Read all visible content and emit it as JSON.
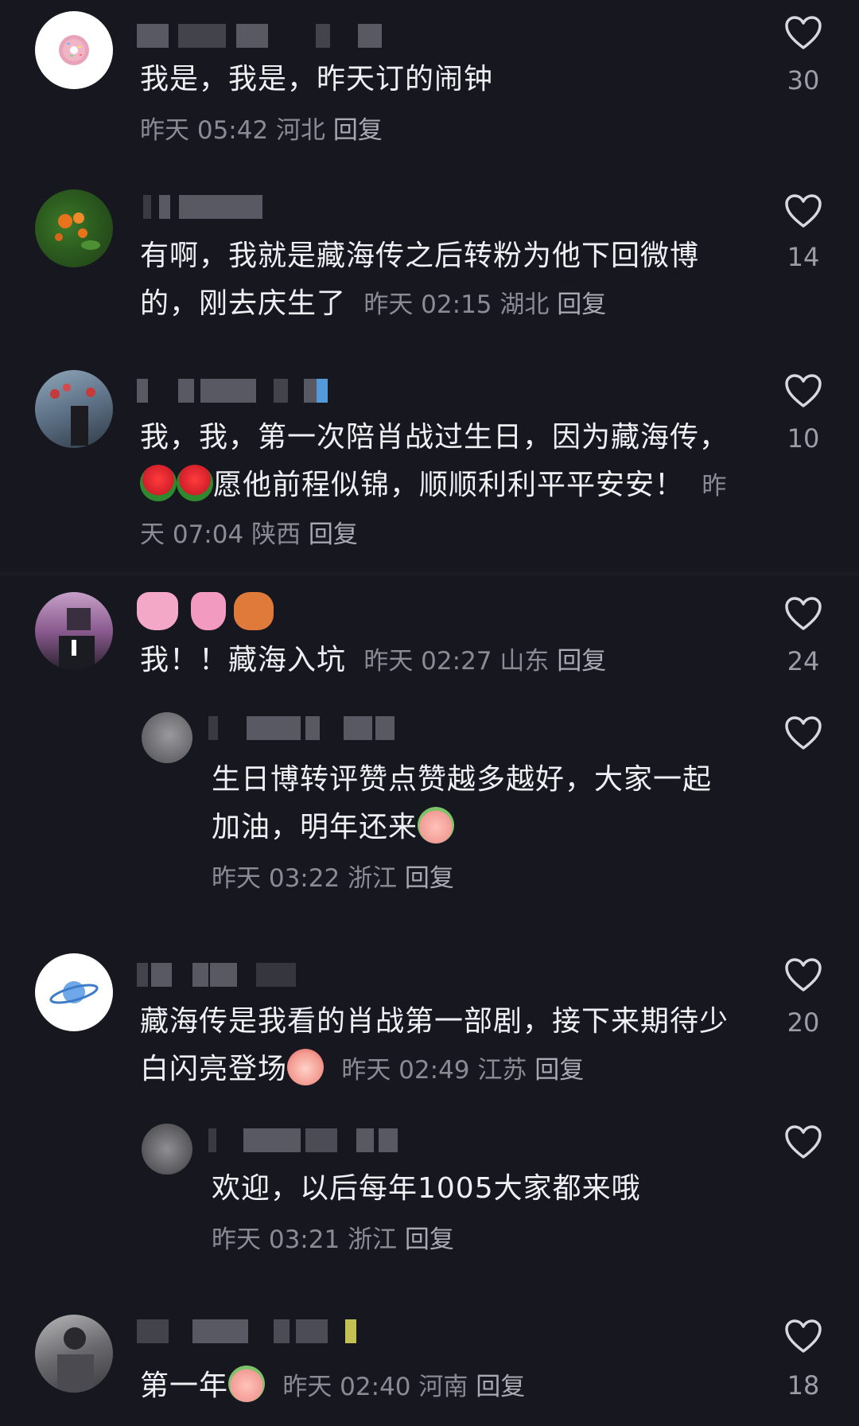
{
  "comments": [
    {
      "text": "我是，我是，昨天订的闹钟",
      "time": "昨天 05:42",
      "region": "河北",
      "reply_label": "回复",
      "likes": "30",
      "avatar_icon": "donut-icon"
    },
    {
      "text": "有啊，我就是藏海传之后转粉为他下回微博的，刚去庆生了",
      "time": "昨天 02:15",
      "region": "湖北",
      "reply_label": "回复",
      "likes": "14",
      "avatar_icon": "flower-photo"
    },
    {
      "text_part1": "我，我，第一次陪肖战过生日，因为藏海传，",
      "text_part2": "愿他前程似锦，顺顺利利平平安安！",
      "time": "昨天 07:04",
      "region": "陕西",
      "reply_label": "回复",
      "likes": "10",
      "emoji": "rose-icon"
    },
    {
      "text": "我！！藏海入坑",
      "time": "昨天 02:27",
      "region": "山东",
      "reply_label": "回复",
      "likes": "24",
      "username_icons": [
        "pink-bunny-icon",
        "pink-bunny-icon",
        "cat-icon"
      ]
    },
    {
      "is_reply": true,
      "text": "生日博转评赞点赞越多越好，大家一起加油，明年还来",
      "time": "昨天 03:22",
      "region": "浙江",
      "reply_label": "回复",
      "emoji": "peach-face-icon"
    },
    {
      "text": "藏海传是我看的肖战第一部剧，接下来期待少白闪亮登场",
      "time": "昨天 02:49",
      "region": "江苏",
      "reply_label": "回复",
      "likes": "20",
      "emoji": "laughing-face-icon",
      "avatar_icon": "planet-icon"
    },
    {
      "is_reply": true,
      "text": "欢迎，以后每年1005大家都来哦",
      "time": "昨天 03:21",
      "region": "浙江",
      "reply_label": "回复"
    },
    {
      "text": "第一年",
      "time": "昨天 02:40",
      "region": "河南",
      "reply_label": "回复",
      "likes": "18",
      "emoji": "peach-face-icon"
    }
  ],
  "colors": {
    "background": "#16171f",
    "text": "#f0f0f4",
    "meta": "#8a8b95",
    "heart": "#d8d8de"
  }
}
